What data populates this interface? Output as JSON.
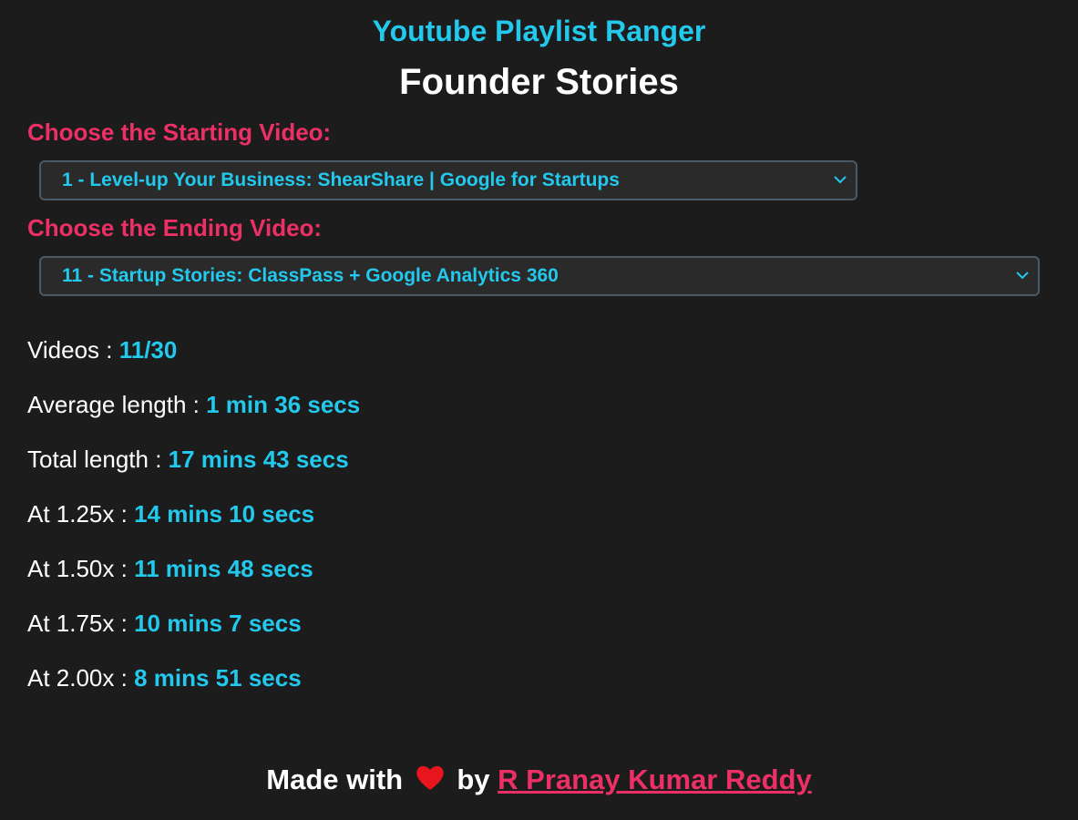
{
  "header": {
    "app_title": "Youtube Playlist Ranger",
    "playlist_title": "Founder Stories"
  },
  "start": {
    "label": "Choose the Starting Video:",
    "selected": "1 - Level-up Your Business: ShearShare | Google for Startups"
  },
  "end": {
    "label": "Choose the Ending Video:",
    "selected": "11 - Startup Stories: ClassPass + Google Analytics 360"
  },
  "stats": [
    {
      "label": "Videos : ",
      "value": "11/30"
    },
    {
      "label": "Average length : ",
      "value": "1 min 36 secs"
    },
    {
      "label": "Total length : ",
      "value": "17 mins 43 secs"
    },
    {
      "label": "At 1.25x : ",
      "value": "14 mins 10 secs"
    },
    {
      "label": "At 1.50x : ",
      "value": "11 mins 48 secs"
    },
    {
      "label": "At 1.75x : ",
      "value": "10 mins 7 secs"
    },
    {
      "label": "At 2.00x : ",
      "value": "8 mins 51 secs"
    }
  ],
  "footer": {
    "made_with": "Made with",
    "by": "by",
    "author": "R Pranay Kumar Reddy",
    "heart_icon": "heart-icon"
  },
  "colors": {
    "background": "#1c1c1c",
    "accent_cyan": "#22c9ec",
    "accent_pink": "#ec3066",
    "heart_red": "#e8161c"
  }
}
